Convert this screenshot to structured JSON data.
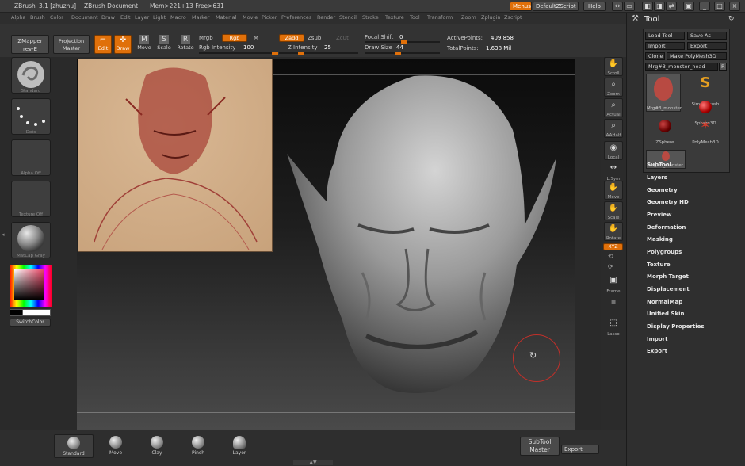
{
  "titlebar": {
    "app": "ZBrush",
    "version": "3.1 [zhuzhu]",
    "doc": "ZBrush Document",
    "mem": "Mem>221+13 Free>631",
    "menus_btn": "Menus",
    "script_btn": "DefaultZScript",
    "help_btn": "Help"
  },
  "menubar": [
    "Alpha",
    "Brush",
    "Color",
    "Document",
    "Draw",
    "Edit",
    "Layer",
    "Light",
    "Macro",
    "Marker",
    "Material",
    "Movie",
    "Picker",
    "Preferences",
    "Render",
    "Stencil",
    "Stroke",
    "Texture",
    "Tool",
    "Transform",
    "Zoom",
    "Zplugin",
    "Zscript"
  ],
  "shelf": {
    "zmapper": "ZMapper",
    "zmapper_rev": "rev-E",
    "projection": "Projection",
    "projection_sub": "Master",
    "edit": "Edit",
    "draw": "Draw",
    "move": "Move",
    "scale": "Scale",
    "rotate": "Rotate",
    "mrgb": "Mrgb",
    "rgb": "Rgb",
    "m": "M",
    "rgb_intensity_label": "Rgb Intensity",
    "rgb_intensity": "100",
    "zadd": "Zadd",
    "zsub": "Zsub",
    "zcut": "Zcut",
    "z_intensity_label": "Z Intensity",
    "z_intensity": "25",
    "focal_label": "Focal Shift",
    "focal": "0",
    "draw_size_label": "Draw Size",
    "draw_size": "44",
    "active_points_label": "ActivePoints:",
    "active_points": "409,858",
    "total_points_label": "TotalPoints:",
    "total_points": "1.638 Mil"
  },
  "leftshelf": [
    "Standard",
    "Dots",
    "Alpha Off",
    "Texture Off",
    "MatCap Gray"
  ],
  "switchcolor": "SwitchColor",
  "rightshelf": [
    "Scroll",
    "Zoom",
    "Actual",
    "AAHalf",
    "Local",
    "L.Sym",
    "Move",
    "Scale",
    "Rotate",
    "Frame",
    "Lasso"
  ],
  "xyz_btn": "XYZ",
  "tool": {
    "title": "Tool",
    "load": "Load Tool",
    "save": "Save As",
    "import": "Import",
    "export": "Export",
    "clone": "Clone",
    "make": "Make PolyMesh3D",
    "current": "Mrg#3_monster_head",
    "r": "R",
    "thumbs": [
      "Mrg#3_monster",
      "SimpleBrush",
      "Sphere3D",
      "ZSphere",
      "PolyMesh3D",
      "Mrg#3_monster"
    ],
    "sections": [
      "SubTool",
      "Layers",
      "Geometry",
      "Geometry HD",
      "Preview",
      "Deformation",
      "Masking",
      "Polygroups",
      "Texture",
      "Morph Target",
      "Displacement",
      "NormalMap",
      "Unified Skin",
      "Display Properties",
      "Import",
      "Export"
    ]
  },
  "bottom": {
    "brushes": [
      "Standard",
      "Move",
      "Clay",
      "Pinch",
      "Layer"
    ],
    "subtool": "SubTool",
    "master": "Master",
    "export": "Export"
  }
}
